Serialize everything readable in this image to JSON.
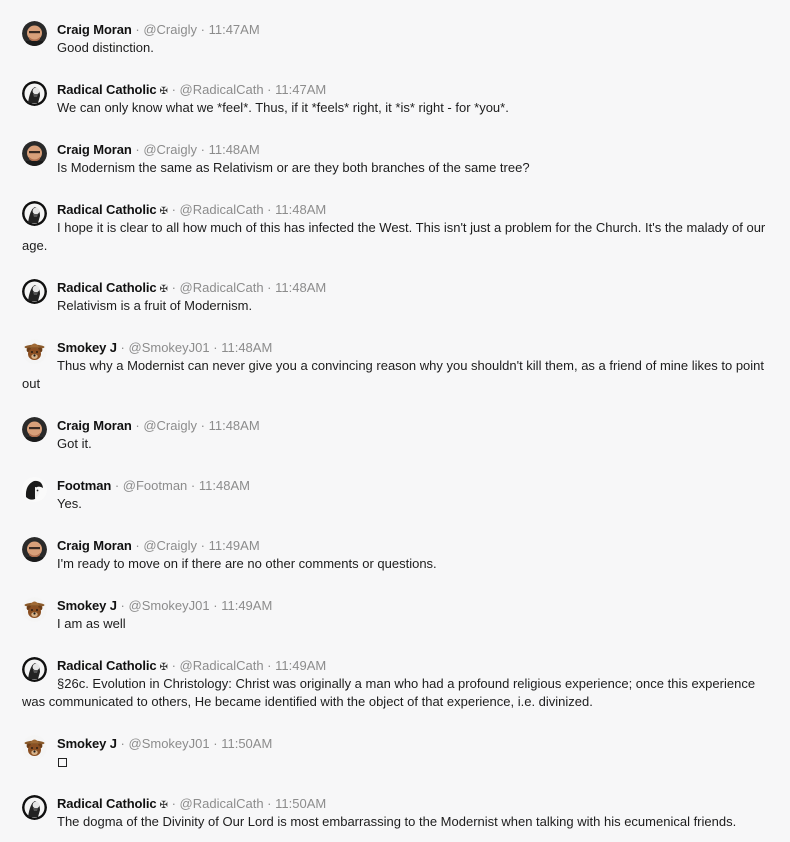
{
  "messages": [
    {
      "name": "Craig Moran",
      "badge": "",
      "handle": "@Craigly",
      "time": "11:47AM",
      "avatar": "craig",
      "text": "Good distinction."
    },
    {
      "name": "Radical Catholic",
      "badge": "✠",
      "handle": "@RadicalCath",
      "time": "11:47AM",
      "avatar": "radical",
      "text": "We can only know what we *feel*. Thus, if it *feels* right, it *is* right - for *you*."
    },
    {
      "name": "Craig Moran",
      "badge": "",
      "handle": "@Craigly",
      "time": "11:48AM",
      "avatar": "craig",
      "text": "Is Modernism the same as Relativism or are they both branches of the same tree?"
    },
    {
      "name": "Radical Catholic",
      "badge": "✠",
      "handle": "@RadicalCath",
      "time": "11:48AM",
      "avatar": "radical",
      "text": "I hope it is clear to all how much of this has infected the West. This isn't just a problem for the Church. It's the malady of our age."
    },
    {
      "name": "Radical Catholic",
      "badge": "✠",
      "handle": "@RadicalCath",
      "time": "11:48AM",
      "avatar": "radical",
      "text": "Relativism is a fruit of Modernism."
    },
    {
      "name": "Smokey J",
      "badge": "",
      "handle": "@SmokeyJ01",
      "time": "11:48AM",
      "avatar": "smokey",
      "text": "Thus why a Modernist can never give you a convincing reason why you shouldn't kill them, as a friend of mine likes to point out"
    },
    {
      "name": "Craig Moran",
      "badge": "",
      "handle": "@Craigly",
      "time": "11:48AM",
      "avatar": "craig",
      "text": "Got it."
    },
    {
      "name": "Footman",
      "badge": "",
      "handle": "@Footman",
      "time": "11:48AM",
      "avatar": "footman",
      "text": "Yes."
    },
    {
      "name": "Craig Moran",
      "badge": "",
      "handle": "@Craigly",
      "time": "11:49AM",
      "avatar": "craig",
      "text": "I'm ready to move on if there are no other comments or questions."
    },
    {
      "name": "Smokey J",
      "badge": "",
      "handle": "@SmokeyJ01",
      "time": "11:49AM",
      "avatar": "smokey",
      "text": "I am as well"
    },
    {
      "name": "Radical Catholic",
      "badge": "✠",
      "handle": "@RadicalCath",
      "time": "11:49AM",
      "avatar": "radical",
      "text": "§26c. Evolution in Christology: Christ was originally a man who had a profound religious experience; once this experience was communicated to others, He became identified with the object of that experience, i.e. divinized."
    },
    {
      "name": "Smokey J",
      "badge": "",
      "handle": "@SmokeyJ01",
      "time": "11:50AM",
      "avatar": "smokey",
      "text": "",
      "icon": "square-emoji-icon"
    },
    {
      "name": "Radical Catholic",
      "badge": "✠",
      "handle": "@RadicalCath",
      "time": "11:50AM",
      "avatar": "radical",
      "text": "The dogma of the Divinity of Our Lord is most embarrassing to the Modernist when talking with his ecumenical friends."
    }
  ],
  "separator": "·"
}
